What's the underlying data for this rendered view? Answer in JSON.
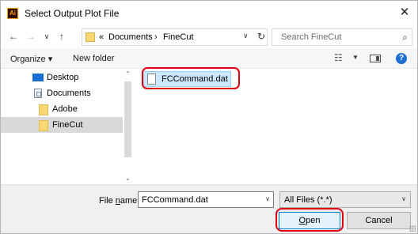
{
  "window": {
    "title": "Select Output Plot File",
    "app_icon_text": "Ai",
    "close_glyph": "✕"
  },
  "nav": {
    "back": "←",
    "forward": "→",
    "recent": "∨",
    "up": "↑",
    "breadcrumb_sep": "«",
    "breadcrumbs": [
      "Documents",
      "FineCut"
    ],
    "crumb_arrow": "›",
    "dropdown_glyph": "∨",
    "refresh_glyph": "↻",
    "search_placeholder": "Search FineCut",
    "search_glyph": "⌕"
  },
  "toolbar": {
    "organize_label": "Organize ▾",
    "new_folder_label": "New folder",
    "view_glyph": "☷",
    "view_dd": "▼",
    "help_glyph": "?"
  },
  "sidebar": {
    "items": [
      {
        "label": "Desktop",
        "icon": "desktop-icon"
      },
      {
        "label": "Documents",
        "icon": "documents-icon"
      },
      {
        "label": "Adobe",
        "icon": "folder-icon"
      },
      {
        "label": "FineCut",
        "icon": "folder-icon",
        "selected": true
      }
    ],
    "scroll_up": "⌃",
    "scroll_down": "⌄"
  },
  "files": [
    {
      "name": "FCCommand.dat",
      "icon": "file-icon",
      "selected": true
    }
  ],
  "footer": {
    "file_name_label_prefix": "File ",
    "file_name_label_accel": "n",
    "file_name_label_suffix": "ame:",
    "file_name_value": "FCCommand.dat",
    "dropdown_glyph": "∨",
    "filter_value": "All Files (*.*)",
    "open_prefix": "",
    "open_accel": "O",
    "open_suffix": "pen",
    "cancel_label": "Cancel"
  },
  "colors": {
    "highlight": "#e0000f",
    "selection": "#cce8ff",
    "accent": "#0078d7"
  }
}
